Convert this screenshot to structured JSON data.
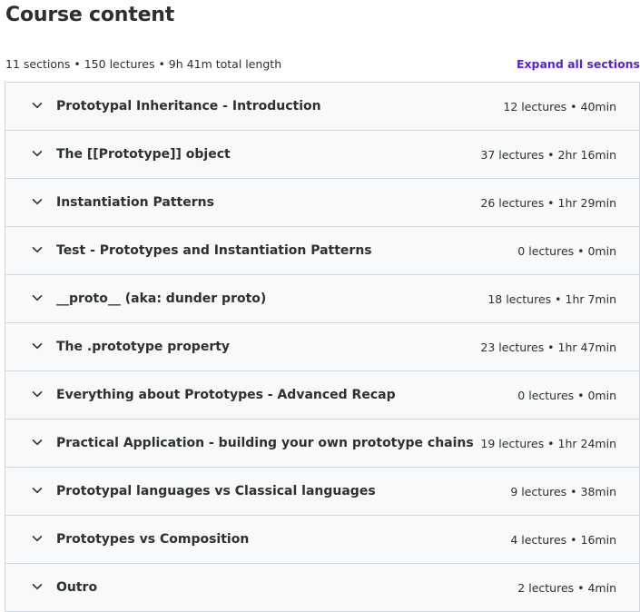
{
  "header": {
    "title": "Course content",
    "summary": "11 sections • 150 lectures • 9h 41m total length",
    "expand_all_label": "Expand all sections"
  },
  "icons": {
    "section_toggle": "chevron-down-icon"
  },
  "colors": {
    "accent": "#5624d0",
    "text": "#2d2f31",
    "section_bg": "#f7f9fa",
    "border": "#d1d7dc"
  },
  "sections": [
    {
      "title": "Prototypal Inheritance - Introduction",
      "meta": "12 lectures • 40min"
    },
    {
      "title": "The [[Prototype]] object",
      "meta": "37 lectures • 2hr 16min"
    },
    {
      "title": "Instantiation Patterns",
      "meta": "26 lectures • 1hr 29min"
    },
    {
      "title": "Test - Prototypes and Instantiation Patterns",
      "meta": "0 lectures • 0min"
    },
    {
      "title": "__proto__ (aka: dunder proto)",
      "meta": "18 lectures • 1hr 7min"
    },
    {
      "title": "The .prototype property",
      "meta": "23 lectures • 1hr 47min"
    },
    {
      "title": "Everything about Prototypes - Advanced Recap",
      "meta": "0 lectures • 0min"
    },
    {
      "title": "Practical Application - building your own prototype chains",
      "meta": "19 lectures • 1hr 24min"
    },
    {
      "title": "Prototypal languages vs Classical languages",
      "meta": "9 lectures • 38min"
    },
    {
      "title": "Prototypes vs Composition",
      "meta": "4 lectures • 16min"
    },
    {
      "title": "Outro",
      "meta": "2 lectures • 4min"
    }
  ]
}
